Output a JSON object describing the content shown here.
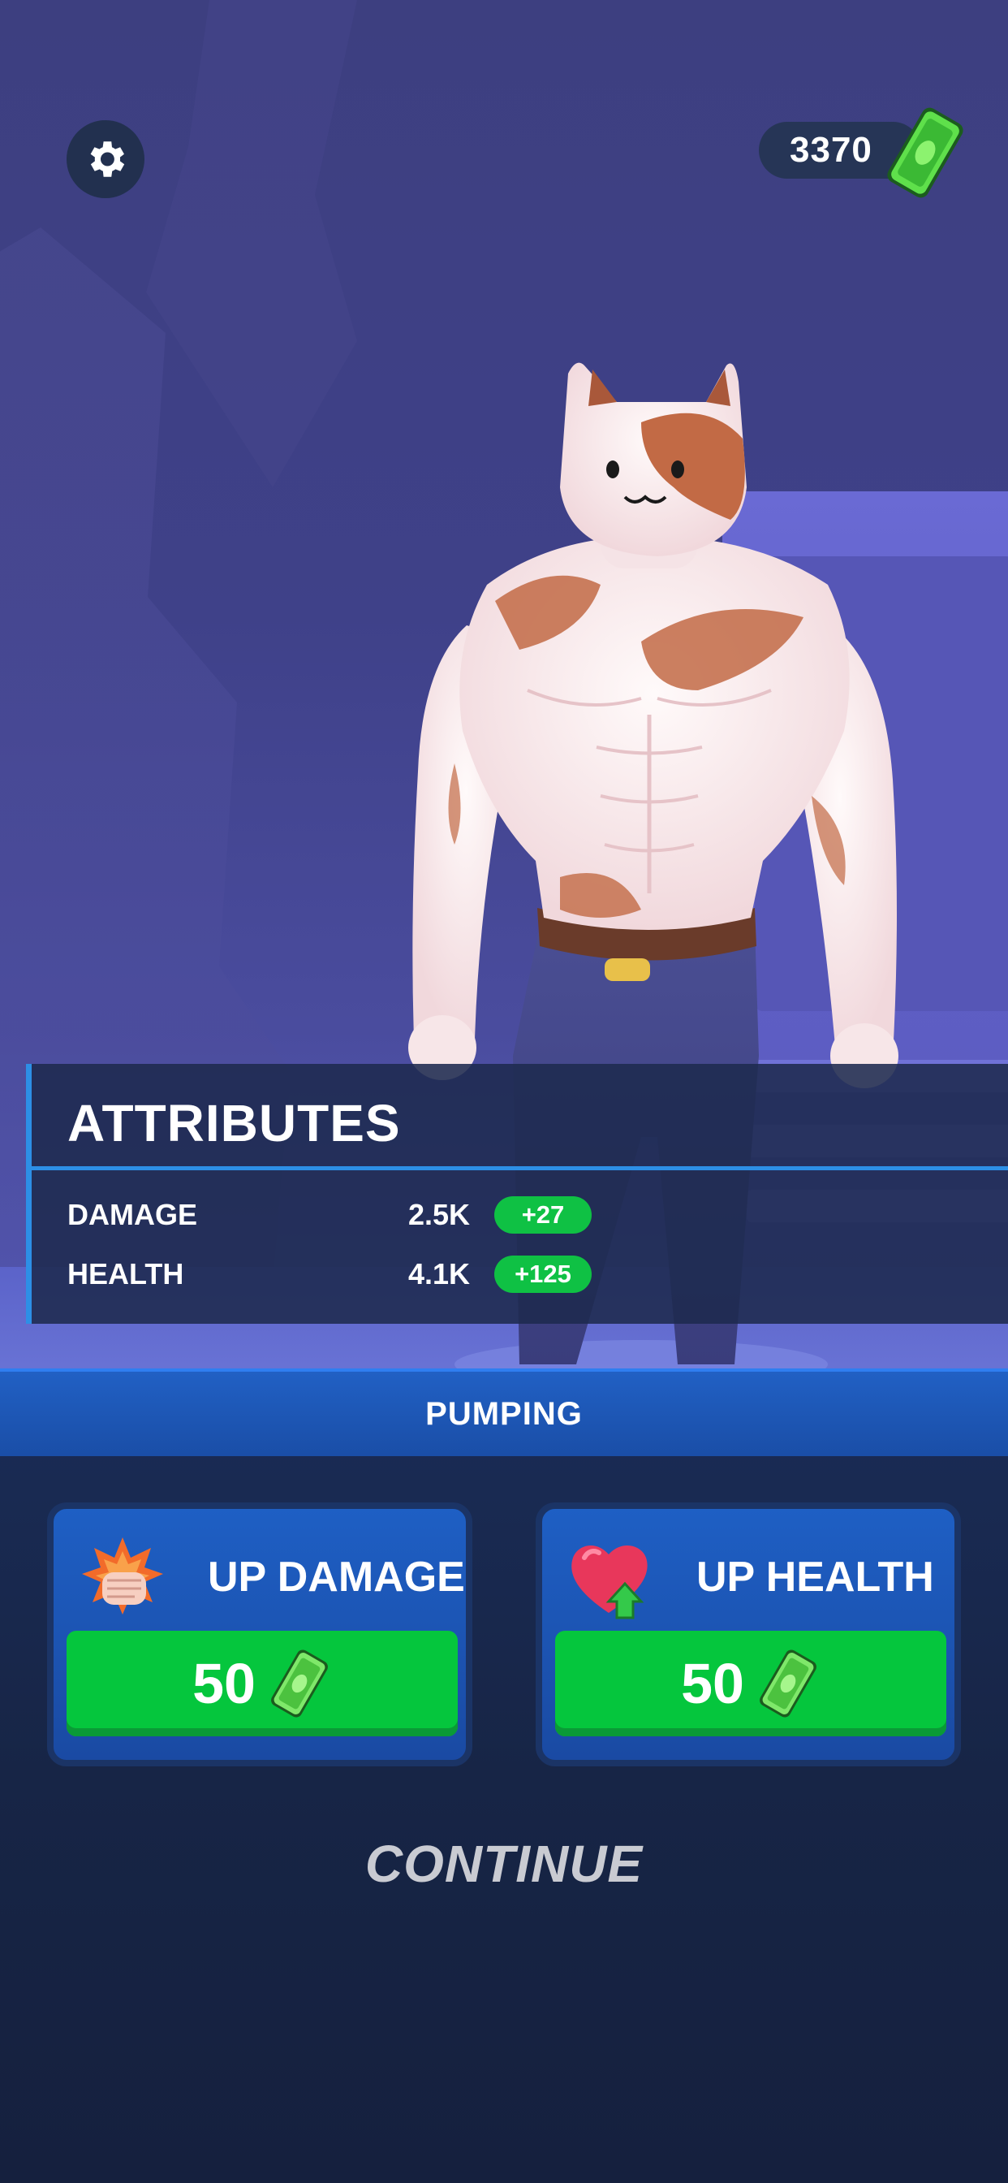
{
  "currency": {
    "amount": "3370",
    "icon": "cash-icon",
    "icon_color": "#3bd14a"
  },
  "settings": {
    "icon": "gear-icon"
  },
  "attributes": {
    "title": "ATTRIBUTES",
    "stats": [
      {
        "label": "DAMAGE",
        "value": "2.5K",
        "delta": "+27"
      },
      {
        "label": "HEALTH",
        "value": "4.1K",
        "delta": "+125"
      }
    ]
  },
  "pumping": {
    "title": "PUMPING",
    "upgrades": [
      {
        "label": "UP DAMAGE",
        "price": "50",
        "icon": "fist-impact-icon"
      },
      {
        "label": "UP HEALTH",
        "price": "50",
        "icon": "heart-up-icon"
      }
    ]
  },
  "continue_label": "CONTINUE",
  "colors": {
    "accent_blue": "#2d8fe6",
    "buy_green": "#05c63d",
    "delta_green": "#0fc144",
    "panel_dark": "#1e2a4e"
  }
}
